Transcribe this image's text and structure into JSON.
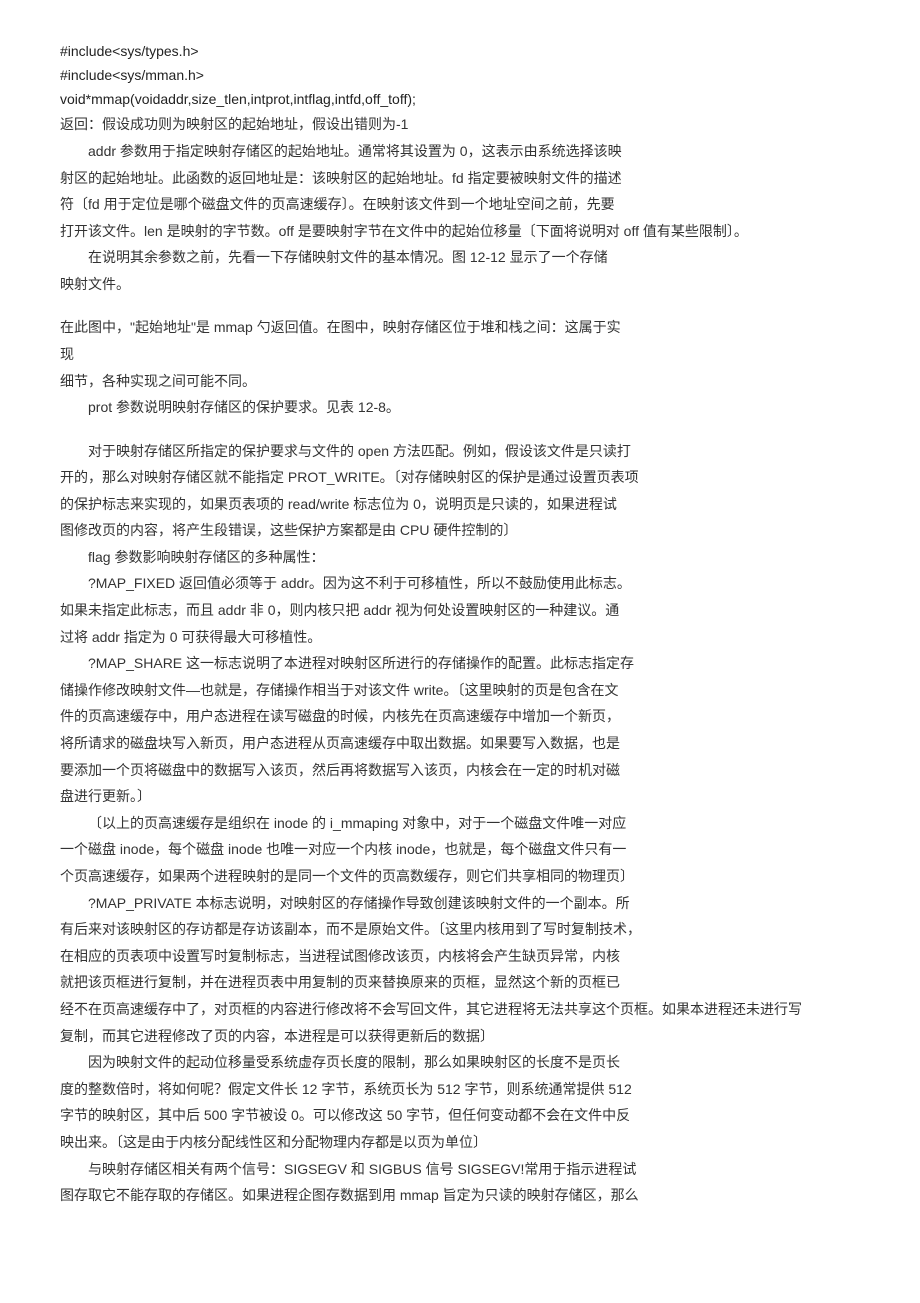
{
  "code": {
    "l1": "#include<sys/types.h>",
    "l2": "#include<sys/mman.h>",
    "l3": "void*mmap(voidaddr,size_tlen,intprot,intflag,intfd,off_toff);"
  },
  "p1": "返回：假设成功则为映射区的起始地址，假设出错则为-1",
  "p2": "addr 参数用于指定映射存储区的起始地址。通常将其设置为 0，这表示由系统选择该映",
  "p3": "射区的起始地址。此函数的返回地址是：该映射区的起始地址。fd 指定要被映射文件的描述",
  "p4": "符〔fd 用于定位是哪个磁盘文件的页高速缓存〕。在映射该文件到一个地址空间之前，先要",
  "p5": "打开该文件。len 是映射的字节数。off 是要映射字节在文件中的起始位移量〔下面将说明对 off 值有某些限制〕。",
  "p6": "在说明其余参数之前，先看一下存储映射文件的基本情况。图 12-12 显示了一个存储",
  "p7": "映射文件。",
  "p8": "在此图中，\"起始地址\"是 mmap 勺返回值。在图中，映射存储区位于堆和栈之间：这属于实",
  "p9": "现",
  "p10": "细节，各种实现之间可能不同。",
  "p11": "prot 参数说明映射存储区的保护要求。见表 12-8。",
  "p12": "对于映射存储区所指定的保护要求与文件的 open 方法匹配。例如，假设该文件是只读打",
  "p13": "开的，那么对映射存储区就不能指定 PROT_WRITE。〔对存储映射区的保护是通过设置页表项",
  "p14": "的保护标志来实现的，如果页表项的 read/write 标志位为 0，说明页是只读的，如果进程试",
  "p15": "图修改页的内容，将产生段错误，这些保护方案都是由 CPU 硬件控制的〕",
  "p16": "flag 参数影响映射存储区的多种属性：",
  "p17": "?MAP_FIXED 返回值必须等于 addr。因为这不利于可移植性，所以不鼓励使用此标志。",
  "p18": "如果未指定此标志，而且 addr 非 0，则内核只把 addr 视为何处设置映射区的一种建议。通",
  "p19": "过将 addr 指定为 0 可获得最大可移植性。",
  "p20": "?MAP_SHARE 这一标志说明了本进程对映射区所进行的存储操作的配置。此标志指定存",
  "p21": "储操作修改映射文件—也就是，存储操作相当于对该文件 write。〔这里映射的页是包含在文",
  "p22": "件的页高速缓存中，用户态进程在读写磁盘的时候，内核先在页高速缓存中增加一个新页，",
  "p23": "将所请求的磁盘块写入新页，用户态进程从页高速缓存中取出数据。如果要写入数据，也是",
  "p24": "要添加一个页将磁盘中的数据写入该页，然后再将数据写入该页，内核会在一定的时机对磁",
  "p25": "盘进行更新。〕",
  "p26": "〔以上的页高速缓存是组织在 inode 的 i_mmaping 对象中，对于一个磁盘文件唯一对应",
  "p27": "一个磁盘 inode，每个磁盘 inode 也唯一对应一个内核 inode，也就是，每个磁盘文件只有一",
  "p28": "个页高速缓存，如果两个进程映射的是同一个文件的页高数缓存，则它们共享相同的物理页〕",
  "p29": "?MAP_PRIVATE 本标志说明，对映射区的存储操作导致创建该映射文件的一个副本。所",
  "p30": "有后来对该映射区的存访都是存访该副本，而不是原始文件。〔这里内核用到了写时复制技术，",
  "p31": "在相应的页表项中设置写时复制标志，当进程试图修改该页，内核将会产生缺页异常，内核",
  "p32": "就把该页框进行复制，并在进程页表中用复制的页来替换原来的页框，显然这个新的页框已",
  "p33": "经不在页高速缓存中了，对页框的内容进行修改将不会写回文件，其它进程将无法共享这个页框。如果本进程还未进行写",
  "p34": "复制，而其它进程修改了页的内容，本进程是可以获得更新后的数据〕",
  "p35": "因为映射文件的起动位移量受系统虚存页长度的限制，那么如果映射区的长度不是页长",
  "p36": "度的整数倍时，将如何呢？假定文件长 12 字节，系统页长为 512 字节，则系统通常提供 512",
  "p37": "字节的映射区，其中后 500 字节被设 0。可以修改这 50 字节，但任何变动都不会在文件中反",
  "p38": "映出来。〔这是由于内核分配线性区和分配物理内存都是以页为单位〕",
  "p39": "与映射存储区相关有两个信号：SIGSEGV 和 SIGBUS 信号 SIGSEGV!常用于指示进程试",
  "p40": "图存取它不能存取的存储区。如果进程企图存数据到用 mmap 旨定为只读的映射存储区，那么"
}
